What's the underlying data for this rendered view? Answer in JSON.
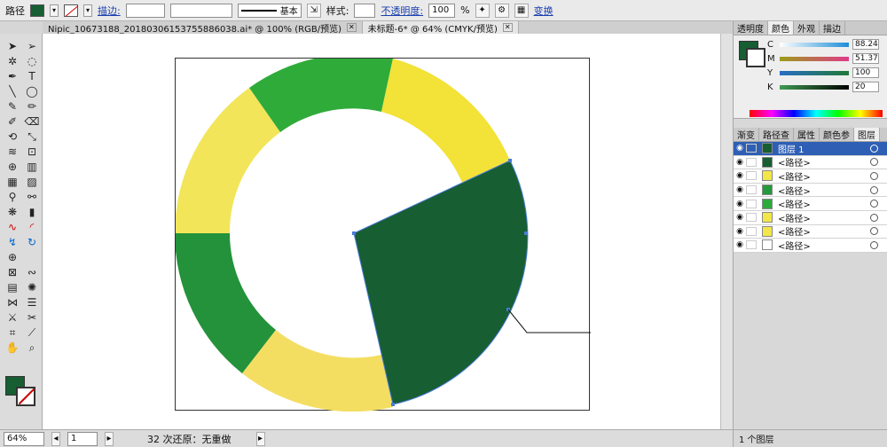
{
  "controlbar": {
    "object_type": "路径",
    "stroke_label": "描边:",
    "stroke_profile": "基本",
    "style_label": "样式:",
    "opacity_label": "不透明度:",
    "opacity_value": "100",
    "percent": "%",
    "transform_link": "变换"
  },
  "tabs": [
    {
      "label": "Nipic_10673188_20180306153755886038.ai* @ 100% (RGB/预览)"
    },
    {
      "label": "未标题-6* @ 64% (CMYK/预览)"
    }
  ],
  "statusbar": {
    "zoom": "64%",
    "artboard": "1",
    "undo_text": "32 次还原：无重做"
  },
  "color_panel": {
    "tabs": [
      "透明度",
      "颜色",
      "外观",
      "描边"
    ],
    "channels": [
      {
        "name": "C",
        "value": "88.24",
        "color": "#1c8ed8"
      },
      {
        "name": "M",
        "value": "51.37",
        "color": "#e03a8a"
      },
      {
        "name": "Y",
        "value": "100",
        "color": "#f2d500"
      },
      {
        "name": "K",
        "value": "20",
        "color": "#000000"
      }
    ]
  },
  "layers_panel": {
    "tabs": [
      "渐变",
      "路径查",
      "属性",
      "颜色参",
      "图层"
    ],
    "layer_name": "图层 1",
    "paths": [
      {
        "label": "<路径>",
        "swatch": "#175e32"
      },
      {
        "label": "<路径>",
        "swatch": "#f3e64a"
      },
      {
        "label": "<路径>",
        "swatch": "#239a3b"
      },
      {
        "label": "<路径>",
        "swatch": "#2bab3b"
      },
      {
        "label": "<路径>",
        "swatch": "#f3e64a"
      },
      {
        "label": "<路径>",
        "swatch": "#f3e64a"
      },
      {
        "label": "<路径>",
        "swatch": "#ffffff"
      }
    ],
    "footer": "1 个图层"
  },
  "art_colors": {
    "dark_green": "#175e32",
    "green": "#2ea33b",
    "yellow": "#f3e64a",
    "soft_yellow": "#f4df64"
  }
}
